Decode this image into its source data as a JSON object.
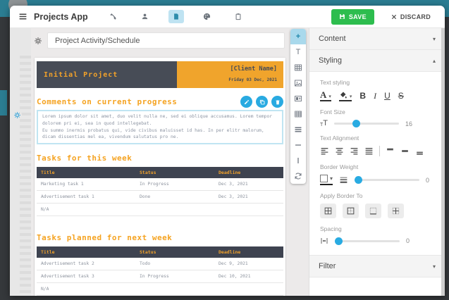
{
  "topbar": {
    "title": "Projects App",
    "save_label": "SAVE",
    "discard_label": "DISCARD"
  },
  "glyphs": {
    "plus": "+",
    "text_tool": "T",
    "hline": "—",
    "vline": "|",
    "caret_down": "▾",
    "caret_up": "▴",
    "color_a": "A",
    "t_small": "T",
    "t_big": "T"
  },
  "editor": {
    "doc_title": "Project Activity/Schedule",
    "document": {
      "banner": {
        "title": "Initial Project",
        "client": "[Client Name]",
        "date": "Friday 03 Dec, 2021"
      },
      "comments": {
        "heading": "Comments on current progress",
        "line1": "Lorem ipsum dolor sit amet, duo velit nulla ne, sed ei oblique accusamus. Lorem tempor dolorem pri ei, sea in quod intellegebat.",
        "line2": "Eu summo inermis probatus qui, vide civibus maluisset id has. In per elitr malorum, dicam dissentias mel ea, vivendum salutatus pro ne."
      },
      "table1": {
        "heading": "Tasks for this week",
        "columns": [
          "Title",
          "Status",
          "Deadline"
        ],
        "rows": [
          [
            "Marketing task 1",
            "In Progress",
            "Dec 3, 2021"
          ],
          [
            "Advertisement task 1",
            "Done",
            "Dec 3, 2021"
          ]
        ],
        "footer": "N/A"
      },
      "table2": {
        "heading": "Tasks planned for next week",
        "columns": [
          "Title",
          "Status",
          "Deadline"
        ],
        "rows": [
          [
            "Advertisement task 2",
            "Todo",
            "Dec 9, 2021"
          ],
          [
            "Advertisement task 3",
            "In Progress",
            "Dec 10, 2021"
          ]
        ],
        "footer": "N/A"
      }
    }
  },
  "inspector": {
    "content_header": "Content",
    "styling_header": "Styling",
    "filter_header": "Filter",
    "text_styling_label": "Text styling",
    "bold": "B",
    "italic": "I",
    "underline": "U",
    "strike": "S",
    "font_size_label": "Font Size",
    "font_size_value": "16",
    "text_alignment_label": "Text Alignment",
    "border_weight_label": "Border Weight",
    "border_weight_value": "0",
    "apply_border_label": "Apply Border To",
    "spacing_label": "Spacing",
    "spacing_value": "0"
  },
  "colors": {
    "accent_blue": "#29abe2",
    "highlight_blue": "#a9d9ec",
    "orange": "#f2a22a",
    "dark_slate": "#474c56",
    "save_green": "#2dbd4e",
    "teal_frame": "#2b7d92"
  }
}
